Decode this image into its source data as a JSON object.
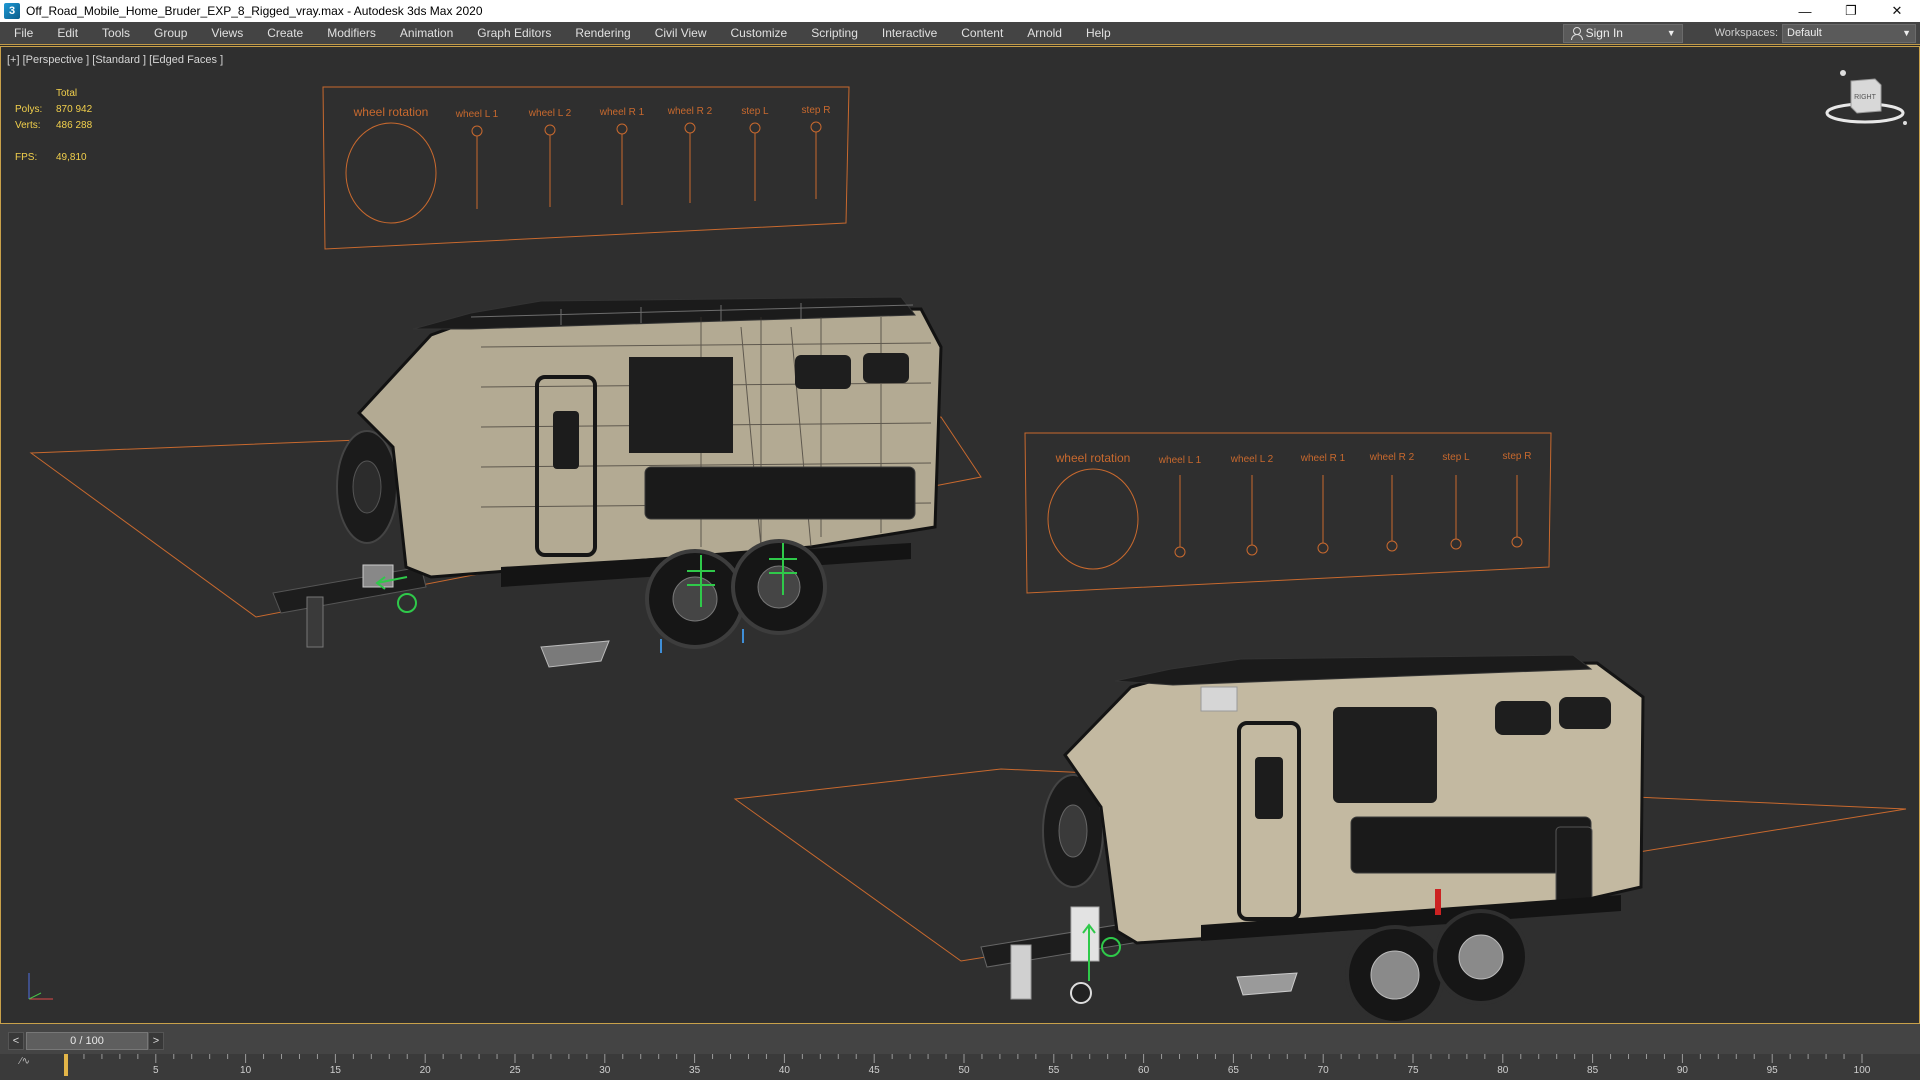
{
  "window": {
    "title": "Off_Road_Mobile_Home_Bruder_EXP_8_Rigged_vray.max - Autodesk 3ds Max 2020",
    "app_icon_glyph": "3",
    "minimize": "—",
    "restore": "❐",
    "close": "✕"
  },
  "menu": {
    "items": [
      "File",
      "Edit",
      "Tools",
      "Group",
      "Views",
      "Create",
      "Modifiers",
      "Animation",
      "Graph Editors",
      "Rendering",
      "Civil View",
      "Customize",
      "Scripting",
      "Interactive",
      "Content",
      "Arnold",
      "Help"
    ],
    "sign_in": "Sign In",
    "workspaces_label": "Workspaces:",
    "workspace_value": "Default",
    "dropdown_glyph": "▼"
  },
  "viewport": {
    "label": "[+] [Perspective ] [Standard ] [Edged Faces ]",
    "stats": {
      "total_label": "Total",
      "polys_label": "Polys:",
      "polys_value": "870 942",
      "verts_label": "Verts:",
      "verts_value": "486 288",
      "fps_label": "FPS:",
      "fps_value": "49,810"
    },
    "control_panels": {
      "labels": [
        "wheel rotation",
        "wheel L 1",
        "wheel L 2",
        "wheel R 1",
        "wheel R 2",
        "step L",
        "step R"
      ]
    },
    "viewcube_label": "RIGHT",
    "colors": {
      "rig_orange": "#c8692e",
      "stats_yellow": "#f2d04c",
      "helper_green": "#2fc94a",
      "frame_gold": "#c9a14a"
    }
  },
  "timeline": {
    "position_label": "0 / 100",
    "prev_glyph": "<",
    "next_glyph": ">",
    "key_glyph": "⁄∿",
    "ticks": [
      "5",
      "10",
      "15",
      "20",
      "25",
      "30",
      "35",
      "40",
      "45",
      "50",
      "55",
      "60",
      "65",
      "70",
      "75",
      "80",
      "85",
      "90",
      "95",
      "100"
    ]
  }
}
